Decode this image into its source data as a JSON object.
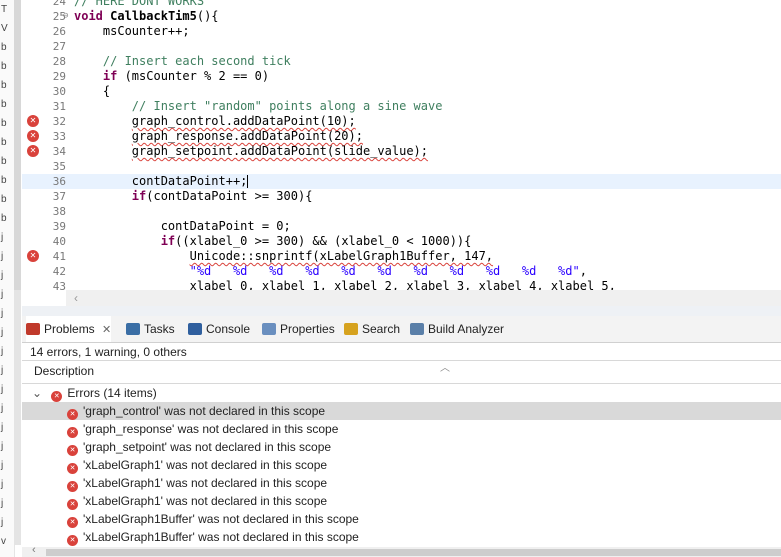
{
  "left_strip": [
    "T",
    "V",
    "b",
    "b",
    "b",
    "b",
    "b",
    "b",
    "b",
    "b",
    "b",
    "b",
    "j",
    "j",
    "j",
    "j",
    "j",
    "j",
    "j",
    "j",
    "j",
    "j",
    "j",
    "j",
    "j",
    "j",
    "j",
    "j",
    "v"
  ],
  "editor": {
    "lines": [
      {
        "n": "24",
        "text": "// HERE DONT WORKS",
        "err": false,
        "kind": "cm"
      },
      {
        "n": "25",
        "text": "void CallbackTim5(){",
        "err": false,
        "kind": "fn",
        "fold": true
      },
      {
        "n": "26",
        "text": "    msCounter++;",
        "err": false
      },
      {
        "n": "27",
        "text": "",
        "err": false
      },
      {
        "n": "28",
        "text": "    // Insert each second tick",
        "err": false,
        "kind": "cm"
      },
      {
        "n": "29",
        "text": "    if (msCounter % 2 == 0)",
        "err": false,
        "kind": "if"
      },
      {
        "n": "30",
        "text": "    {",
        "err": false
      },
      {
        "n": "31",
        "text": "        // Insert \"random\" points along a sine wave",
        "err": false,
        "kind": "cm"
      },
      {
        "n": "32",
        "text": "        graph_control.addDataPoint(10);",
        "err": true,
        "kind": "squig"
      },
      {
        "n": "33",
        "text": "        graph_response.addDataPoint(20);",
        "err": true,
        "kind": "squig"
      },
      {
        "n": "34",
        "text": "        graph_setpoint.addDataPoint(slide_value);",
        "err": true,
        "kind": "squig"
      },
      {
        "n": "35",
        "text": "",
        "err": false
      },
      {
        "n": "36",
        "text": "        contDataPoint++;",
        "err": false,
        "current": true
      },
      {
        "n": "37",
        "text": "        if(contDataPoint >= 300){",
        "err": false,
        "kind": "if"
      },
      {
        "n": "38",
        "text": "",
        "err": false
      },
      {
        "n": "39",
        "text": "            contDataPoint = 0;",
        "err": false
      },
      {
        "n": "40",
        "text": "            if((xlabel_0 >= 300) && (xlabel_0 < 1000)){",
        "err": false,
        "kind": "if"
      },
      {
        "n": "41",
        "text": "                Unicode::snprintf(xLabelGraph1Buffer, 147,",
        "err": true,
        "kind": "squig"
      },
      {
        "n": "42",
        "text": "                \"%d   %d   %d   %d   %d   %d   %d   %d   %d   %d   %d\",",
        "err": false,
        "kind": "str"
      },
      {
        "n": "43",
        "text": "                xlabel_0, xlabel_1, xlabel_2, xlabel_3, xlabel_4, xlabel_5,",
        "err": false
      }
    ]
  },
  "panel": {
    "tabs": [
      {
        "label": "Problems",
        "active": true,
        "close": "✕"
      },
      {
        "label": "Tasks"
      },
      {
        "label": "Console"
      },
      {
        "label": "Properties"
      },
      {
        "label": "Search"
      },
      {
        "label": "Build Analyzer"
      }
    ],
    "summary": "14 errors, 1 warning, 0 others",
    "column": "Description",
    "group": "Errors (14 items)",
    "errors": [
      "'graph_control' was not declared in this scope",
      "'graph_response' was not declared in this scope",
      "'graph_setpoint' was not declared in this scope",
      "'xLabelGraph1' was not declared in this scope",
      "'xLabelGraph1' was not declared in this scope",
      "'xLabelGraph1' was not declared in this scope",
      "'xLabelGraph1Buffer' was not declared in this scope",
      "'xLabelGraph1Buffer' was not declared in this scope"
    ]
  },
  "icons": {
    "error": "error-icon",
    "problems": "problems-icon",
    "tasks": "tasks-icon",
    "console": "console-icon",
    "properties": "properties-icon",
    "search": "search-icon",
    "build": "build-analyzer-icon"
  },
  "colors": {
    "error": "#d9423b",
    "keyword": "#7f0055",
    "comment": "#3f7f5f",
    "string": "#2a00ff",
    "current_line": "#e8f2fe"
  }
}
